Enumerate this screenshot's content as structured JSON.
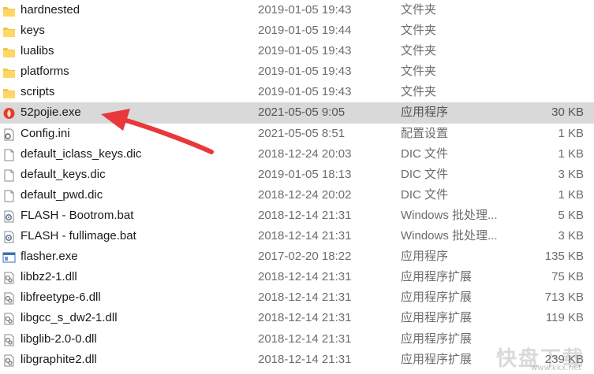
{
  "files": [
    {
      "name": "hardnested",
      "date": "2019-01-05 19:43",
      "type": "文件夹",
      "size": "",
      "icon": "folder-icon"
    },
    {
      "name": "keys",
      "date": "2019-01-05 19:44",
      "type": "文件夹",
      "size": "",
      "icon": "folder-icon"
    },
    {
      "name": "lualibs",
      "date": "2019-01-05 19:43",
      "type": "文件夹",
      "size": "",
      "icon": "folder-icon"
    },
    {
      "name": "platforms",
      "date": "2019-01-05 19:43",
      "type": "文件夹",
      "size": "",
      "icon": "folder-icon"
    },
    {
      "name": "scripts",
      "date": "2019-01-05 19:43",
      "type": "文件夹",
      "size": "",
      "icon": "folder-icon"
    },
    {
      "name": "52pojie.exe",
      "date": "2021-05-05 9:05",
      "type": "应用程序",
      "size": "30 KB",
      "icon": "app-red-icon",
      "selected": true
    },
    {
      "name": "Config.ini",
      "date": "2021-05-05 8:51",
      "type": "配置设置",
      "size": "1 KB",
      "icon": "config-file-icon"
    },
    {
      "name": "default_iclass_keys.dic",
      "date": "2018-12-24 20:03",
      "type": "DIC 文件",
      "size": "1 KB",
      "icon": "blank-file-icon"
    },
    {
      "name": "default_keys.dic",
      "date": "2019-01-05 18:13",
      "type": "DIC 文件",
      "size": "3 KB",
      "icon": "blank-file-icon"
    },
    {
      "name": "default_pwd.dic",
      "date": "2018-12-24 20:02",
      "type": "DIC 文件",
      "size": "1 KB",
      "icon": "blank-file-icon"
    },
    {
      "name": "FLASH - Bootrom.bat",
      "date": "2018-12-14 21:31",
      "type": "Windows 批处理...",
      "size": "5 KB",
      "icon": "batch-file-icon"
    },
    {
      "name": "FLASH - fullimage.bat",
      "date": "2018-12-14 21:31",
      "type": "Windows 批处理...",
      "size": "3 KB",
      "icon": "batch-file-icon"
    },
    {
      "name": "flasher.exe",
      "date": "2017-02-20 18:22",
      "type": "应用程序",
      "size": "135 KB",
      "icon": "app-window-icon"
    },
    {
      "name": "libbz2-1.dll",
      "date": "2018-12-14 21:31",
      "type": "应用程序扩展",
      "size": "75 KB",
      "icon": "dll-file-icon"
    },
    {
      "name": "libfreetype-6.dll",
      "date": "2018-12-14 21:31",
      "type": "应用程序扩展",
      "size": "713 KB",
      "icon": "dll-file-icon"
    },
    {
      "name": "libgcc_s_dw2-1.dll",
      "date": "2018-12-14 21:31",
      "type": "应用程序扩展",
      "size": "119 KB",
      "icon": "dll-file-icon"
    },
    {
      "name": "libglib-2.0-0.dll",
      "date": "2018-12-14 21:31",
      "type": "应用程序扩展",
      "size": "",
      "icon": "dll-file-icon"
    },
    {
      "name": "libgraphite2.dll",
      "date": "2018-12-14 21:31",
      "type": "应用程序扩展",
      "size": "239 KB",
      "icon": "dll-file-icon"
    }
  ],
  "watermark": {
    "text": "快盘下载",
    "url": "www.kkx.net"
  },
  "colors": {
    "selected_row": "#d9d9d9",
    "folder": "#f4c443",
    "arrow": "#e8383b"
  }
}
